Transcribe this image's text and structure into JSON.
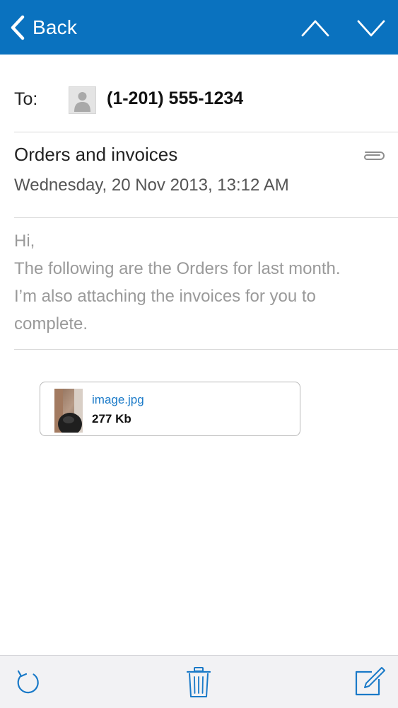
{
  "nav": {
    "back_label": "Back",
    "accent_color": "#0a72bf",
    "icons": [
      "chevron-left-icon",
      "chevron-up-icon",
      "chevron-down-icon"
    ]
  },
  "header": {
    "to_label": "To:",
    "recipient": "(1-201) 555-1234"
  },
  "message": {
    "subject": "Orders and invoices",
    "date": "Wednesday, 20 Nov 2013, 13:12 AM",
    "body_lines": [
      "Hi,",
      "The following are the Orders for last month.",
      "I’m also attaching the invoices for you to",
      "complete."
    ]
  },
  "attachment": {
    "name": "image.jpg",
    "size": "277 Kb"
  },
  "toolbar": {
    "icons": [
      "refresh-icon",
      "trash-icon",
      "compose-icon"
    ],
    "icon_color": "#1a7ac8"
  }
}
